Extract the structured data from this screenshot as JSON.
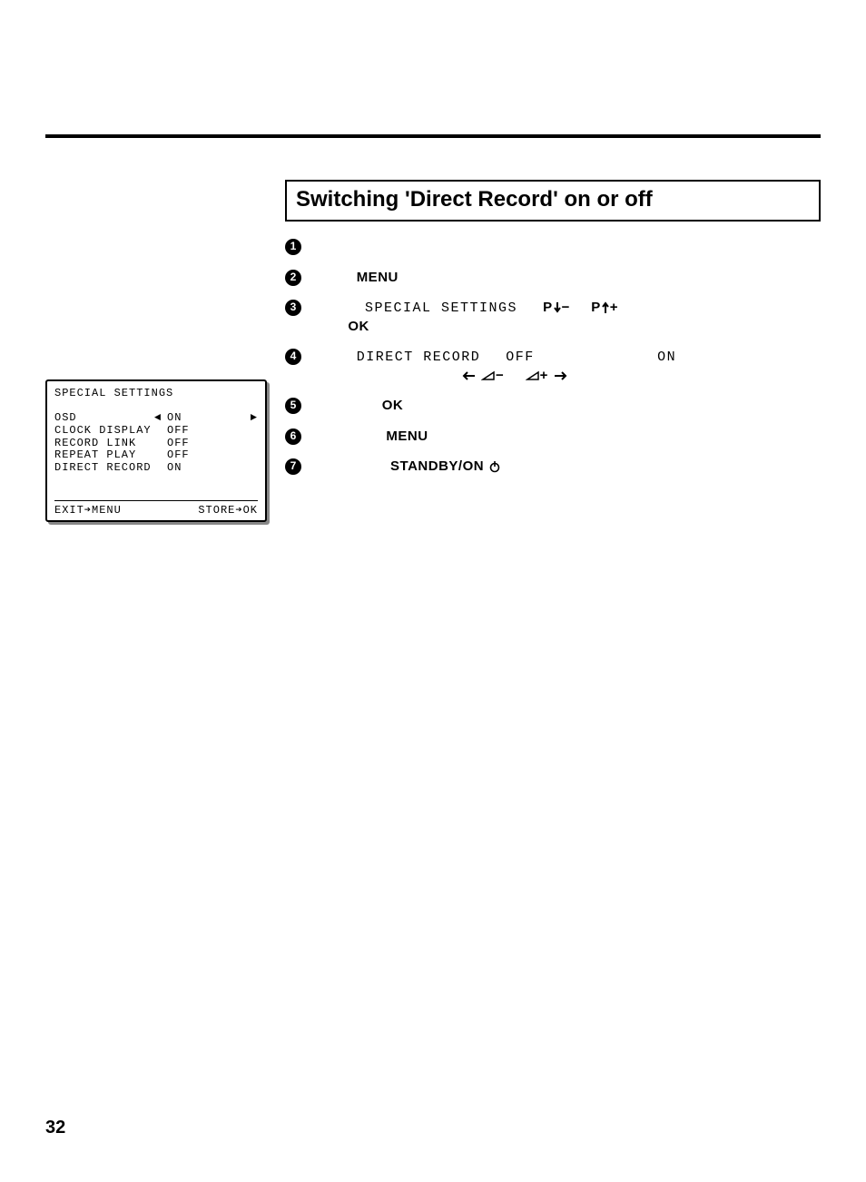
{
  "heading": "Switching 'Direct Record' on or off",
  "steps": {
    "s1_bullet": "1",
    "s2_bullet": "2",
    "s2_label": "MENU",
    "s3_bullet": "3",
    "s3_menu": "SPECIAL SETTINGS",
    "s3_ok": "OK",
    "s3_pd": "P",
    "s3_pu": "P",
    "s4_bullet": "4",
    "s4_item": "DIRECT RECORD",
    "s4_off": "OFF",
    "s4_on": "ON",
    "s5_bullet": "5",
    "s5_ok": "OK",
    "s6_bullet": "6",
    "s6_menu": "MENU",
    "s7_bullet": "7",
    "s7_standby": "STANDBY/ON"
  },
  "osd": {
    "title": "SPECIAL SETTINGS",
    "rows": [
      {
        "label": "OSD",
        "value": "ON",
        "sel": true
      },
      {
        "label": "CLOCK DISPLAY",
        "value": "OFF",
        "sel": false
      },
      {
        "label": "RECORD LINK",
        "value": "OFF",
        "sel": false
      },
      {
        "label": "REPEAT PLAY",
        "value": "OFF",
        "sel": false
      },
      {
        "label": "DIRECT RECORD",
        "value": "ON",
        "sel": false
      }
    ],
    "footer_left": "EXIT➔MENU",
    "footer_right": "STORE➔OK"
  },
  "page_number": "32"
}
